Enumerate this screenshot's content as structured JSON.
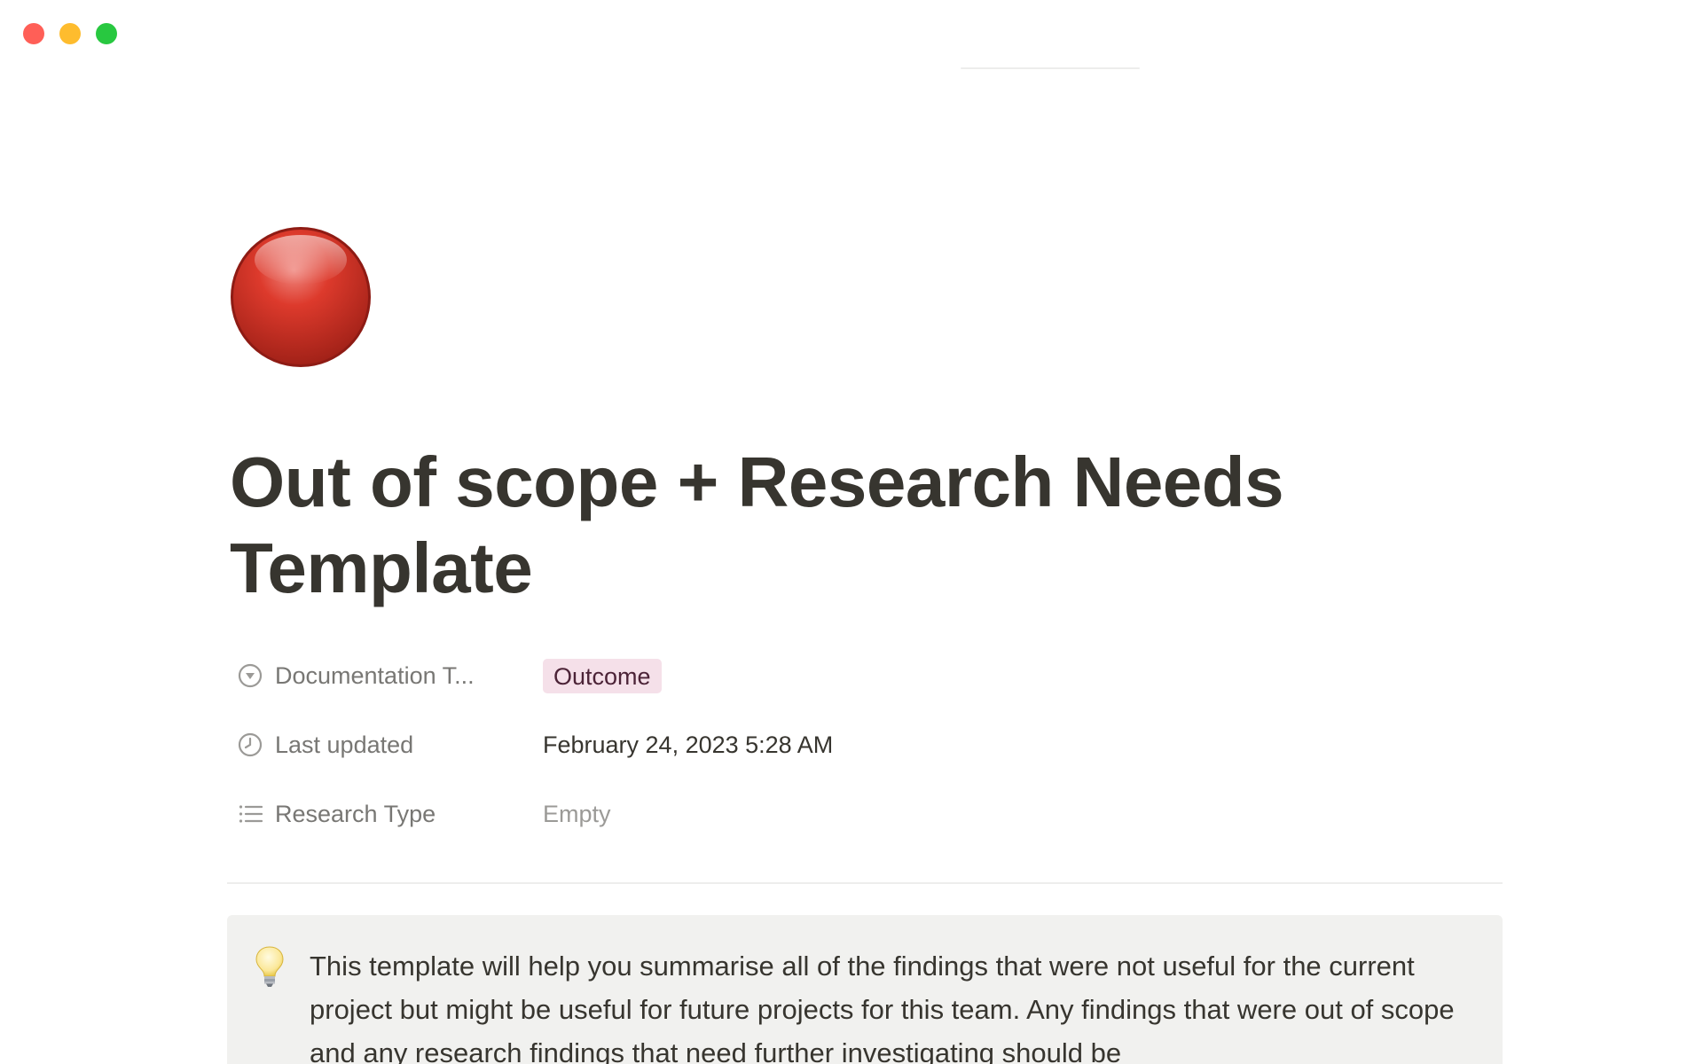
{
  "window": {
    "controls": {
      "close_color": "#ff5f57",
      "minimize_color": "#febc2e",
      "zoom_color": "#28c840"
    }
  },
  "page": {
    "icon": "red-circle-icon",
    "title": "Out of scope + Research Needs Template"
  },
  "properties": [
    {
      "icon": "select-icon",
      "name": "Documentation T...",
      "value": "Outcome",
      "value_type": "tag",
      "tag_color": "#f5e0e9"
    },
    {
      "icon": "clock-icon",
      "name": "Last updated",
      "value": "February 24, 2023 5:28 AM",
      "value_type": "text"
    },
    {
      "icon": "list-icon",
      "name": "Research Type",
      "value": "Empty",
      "value_type": "empty"
    }
  ],
  "callout": {
    "icon": "light-bulb-icon",
    "text": "This template will help you summarise all of the findings that were not useful for the current project but might be useful for future projects for this team. Any findings that were out of scope and any research findings that need further investigating should be"
  },
  "colors": {
    "text": "#37352f",
    "muted": "#787774",
    "placeholder": "#9b9a97",
    "callout_bg": "#f1f1ef",
    "divider": "#ededec"
  }
}
